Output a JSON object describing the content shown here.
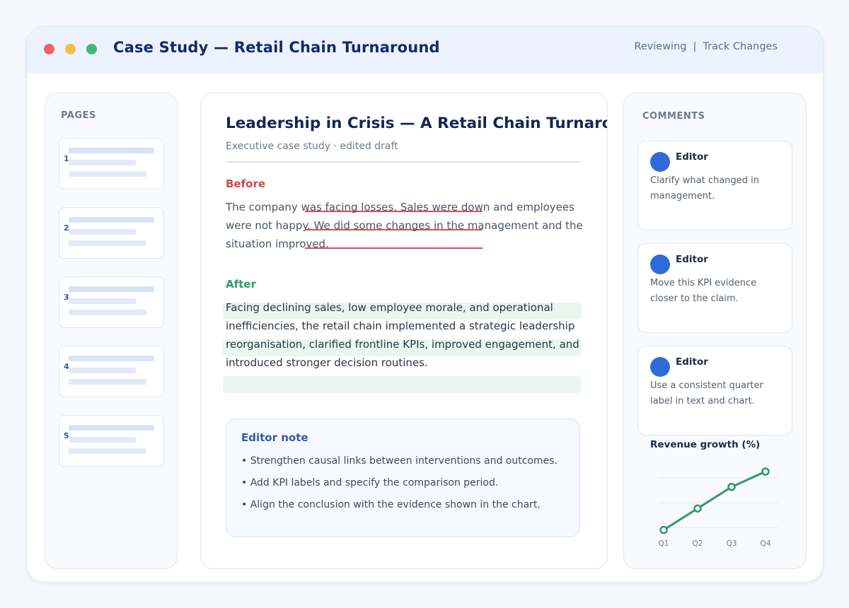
{
  "window": {
    "title": "Case Study — Retail Chain Turnaround",
    "mode_label": "Reviewing",
    "mode_separator": "|",
    "track_changes_label": "Track Changes"
  },
  "pages_panel": {
    "title": "PAGES",
    "pages": [
      {
        "number": "1"
      },
      {
        "number": "2"
      },
      {
        "number": "3"
      },
      {
        "number": "4"
      },
      {
        "number": "5"
      }
    ]
  },
  "document": {
    "title": "Leadership in Crisis — A Retail Chain Turnaround",
    "subtitle": "Executive case study · edited draft",
    "before_heading": "Before",
    "before_text": "The company was facing losses. Sales were down and employees were not happy. We did some changes in the management and the situation improved.",
    "after_heading": "After",
    "after_text": "Facing declining sales, low employee morale, and operational inefficiencies, the retail chain implemented a strategic leadership reorganisation, clarified frontline KPIs, improved engagement, and introduced stronger decision routines."
  },
  "editor_note": {
    "title": "Editor note",
    "items": [
      "• Strengthen causal links between interventions and outcomes.",
      "• Add KPI labels and specify the comparison period.",
      "• Align the conclusion with the evidence shown in the chart."
    ]
  },
  "comments_panel": {
    "title": "COMMENTS",
    "comments": [
      {
        "author": "Editor",
        "text": "Clarify what changed in management."
      },
      {
        "author": "Editor",
        "text": "Move this KPI evidence closer to the claim."
      },
      {
        "author": "Editor",
        "text": "Use a consistent quarter label in text and chart."
      }
    ]
  },
  "colors": {
    "accent_blue": "#2f6bd8",
    "title_navy": "#14296b",
    "before_red": "#cb4a45",
    "after_green": "#2e9a63",
    "chart_line": "#2e9a63"
  },
  "chart_data": {
    "type": "line",
    "title": "Revenue growth (%)",
    "categories": [
      "Q1",
      "Q2",
      "Q3",
      "Q4"
    ],
    "series": [
      {
        "values": [
          -1.5,
          2.0,
          5.5,
          8.0
        ]
      }
    ],
    "ylim": [
      -2,
      8
    ],
    "grid": true,
    "legend": "none"
  }
}
